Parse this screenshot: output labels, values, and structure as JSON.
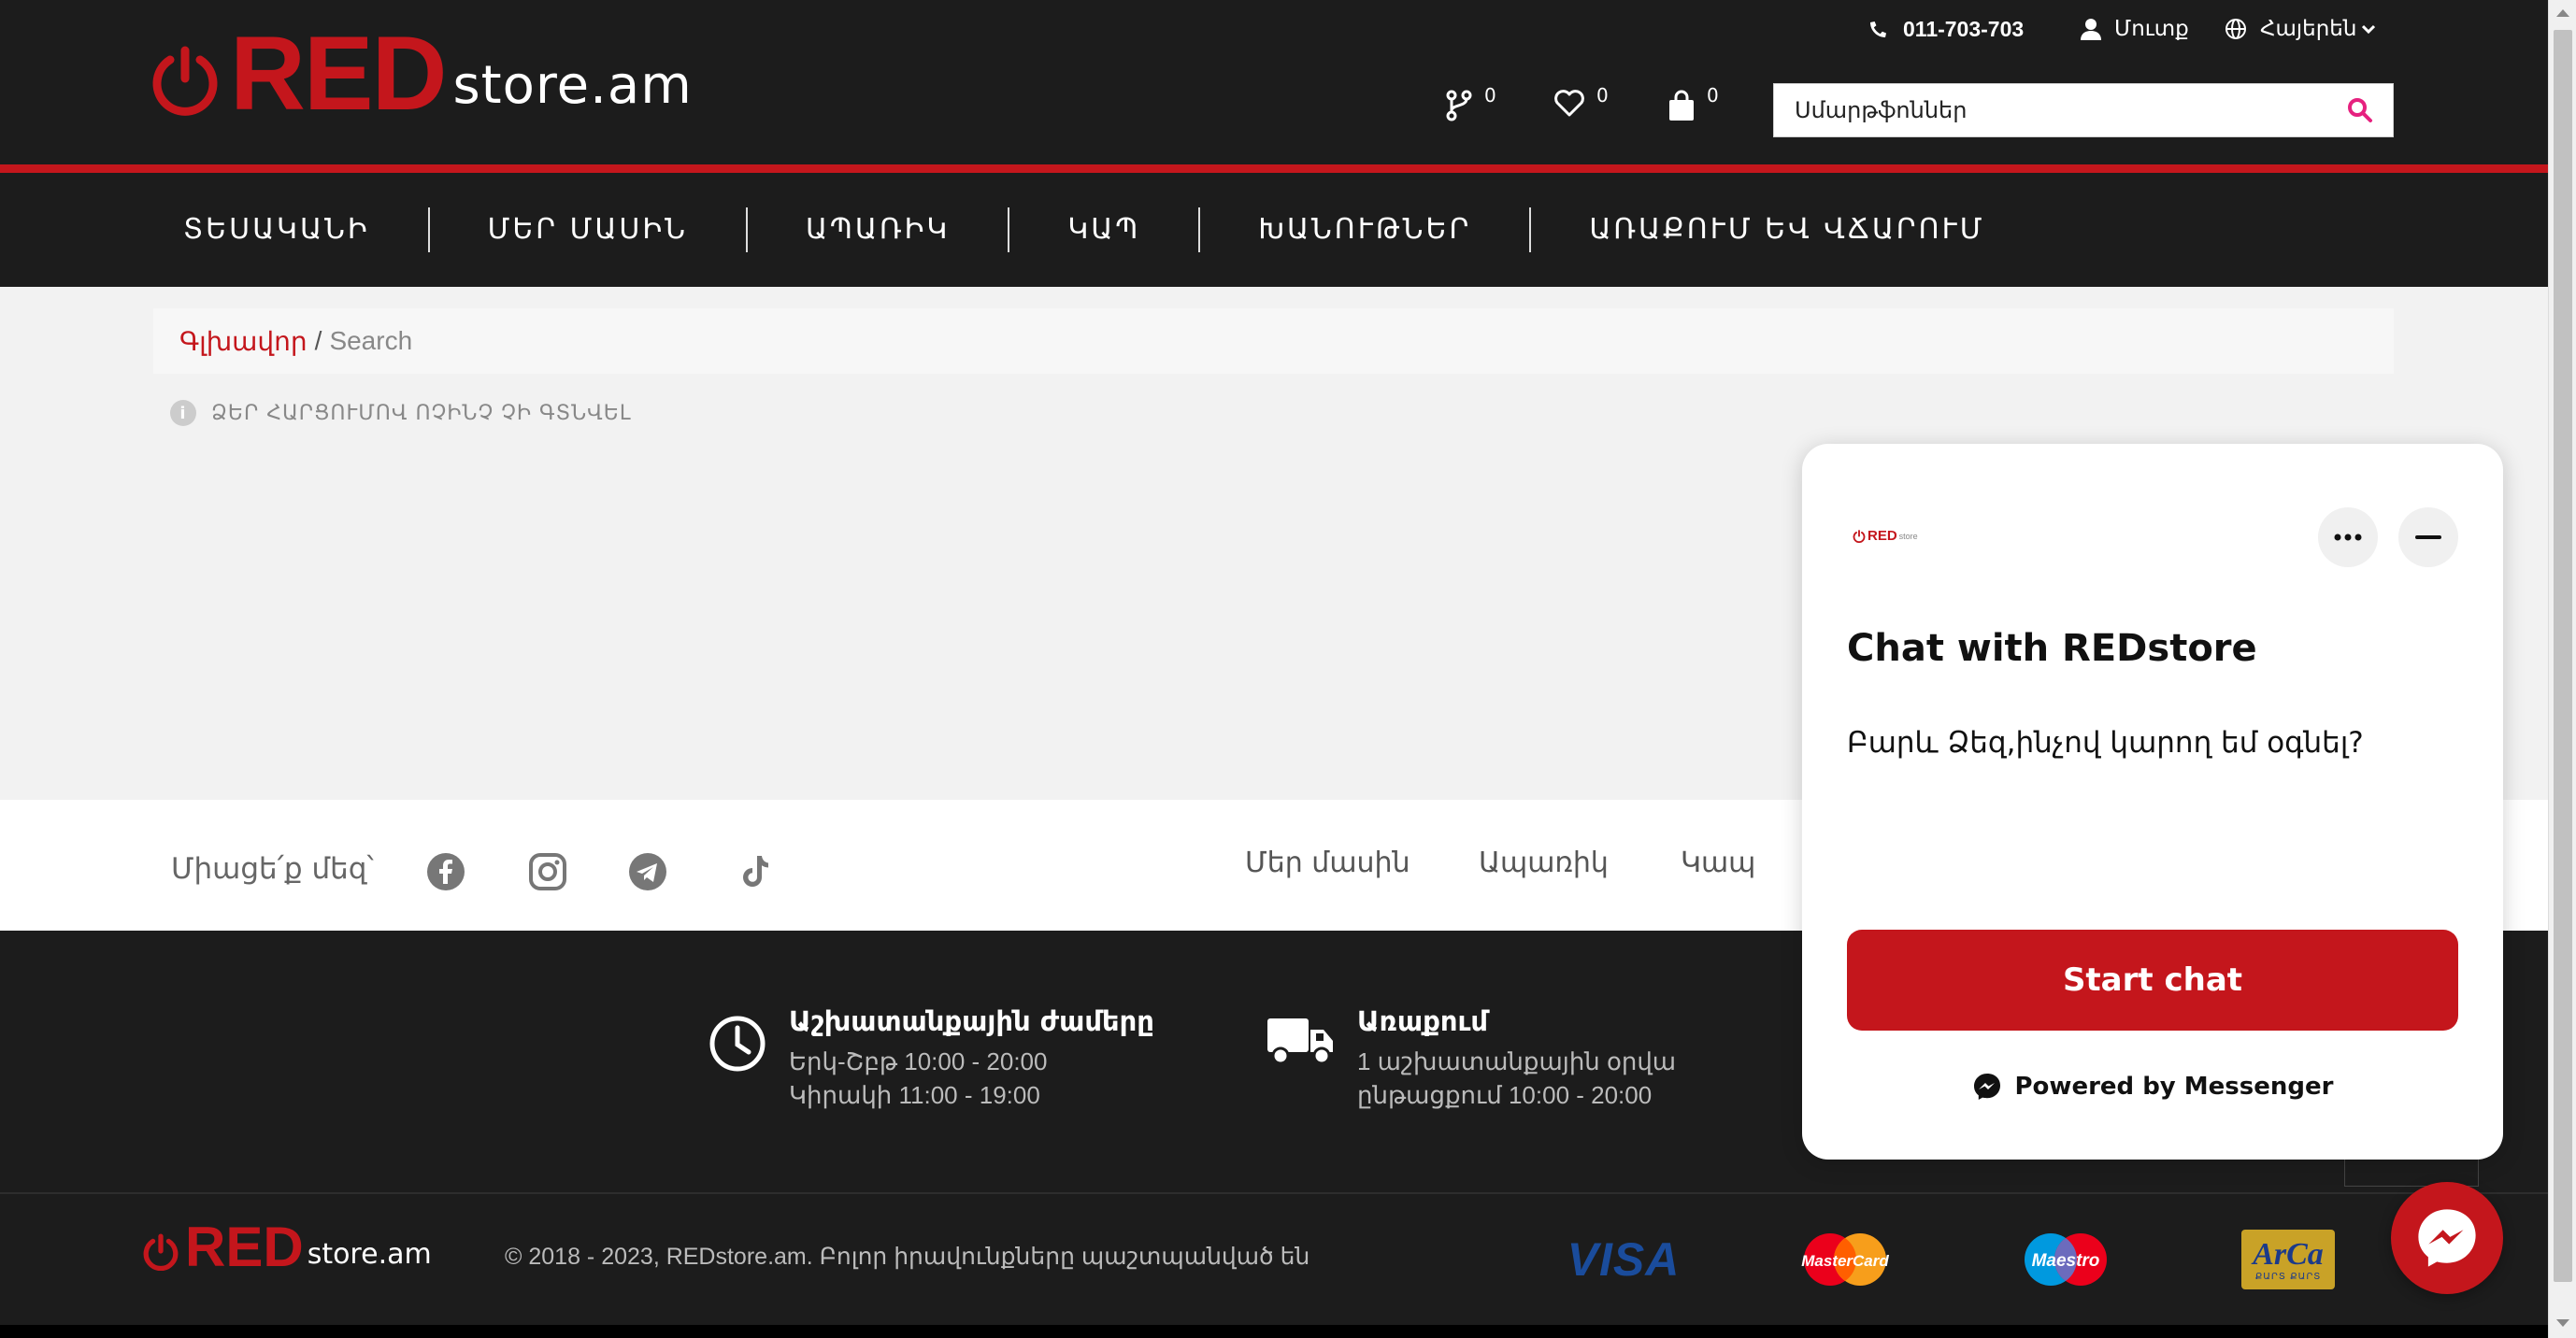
{
  "header": {
    "logo": {
      "red": "RED",
      "rest": "store.am"
    },
    "phone": "011-703-703",
    "login": "Մուտք",
    "language": "Հայերեն",
    "compare_count": "0",
    "wishlist_count": "0",
    "cart_count": "0",
    "search": {
      "value": "Սմարթֆոններ",
      "placeholder": "Սմարթֆոններ"
    }
  },
  "nav": {
    "items": [
      {
        "label": "ՏԵՍԱԿԱՆԻ"
      },
      {
        "label": "ՄԵՐ ՄԱՍԻՆ"
      },
      {
        "label": "ԱՊԱՌԻԿ"
      },
      {
        "label": "ԿԱՊ"
      },
      {
        "label": "ԽԱՆՈՒԹՆԵՐ"
      },
      {
        "label": "ԱՌԱՔՈՒՄ ԵՎ ՎՃԱՐՈՒՄ"
      }
    ]
  },
  "breadcrumb": {
    "home": "Գլխավոր",
    "separator": "/",
    "current": "Search"
  },
  "notice": "ՁԵՐ ՀԱՐՑՈՒՄՈՎ ՈՉԻՆՉ ՉԻ ԳՏՆՎԵԼ",
  "footer": {
    "join_label": "Միացե՛ք մեզ՝",
    "social": [
      "facebook-icon",
      "instagram-icon",
      "telegram-icon",
      "tiktok-icon"
    ],
    "links": [
      {
        "label": "Մեր մասին"
      },
      {
        "label": "Ապառիկ"
      },
      {
        "label": "Կապ"
      }
    ],
    "hours": {
      "title": "Աշխատանքային ժամերը",
      "line1": "Երկ-Շբթ 10:00 -  20:00",
      "line2": "Կիրակի 11:00 - 19:00"
    },
    "delivery": {
      "title": "Առաքում",
      "line1": "1 աշխատանքային օրվա",
      "line2": "ընթացքում 10:00 - 20:00"
    },
    "logo": {
      "red": "RED",
      "rest": "store.am"
    },
    "copyright": "© 2018 - 2023, REDstore.am. Բոլոր իրավունքները պաշտպանված են",
    "payments": {
      "visa": "VISA",
      "mastercard": "MasterCard",
      "maestro": "Maestro",
      "arca": "ArCa",
      "arca_sub": "ՔԱՐՏ ՔԱՐՏ"
    }
  },
  "chat": {
    "logo_red": "RED",
    "logo_rest": "store",
    "title": "Chat with REDstore",
    "message": "Բարև Ձեզ,ինչով կարող եմ օգնել?",
    "start_label": "Start chat",
    "powered": "Powered by Messenger"
  },
  "colors": {
    "brand_red": "#c4161c",
    "dark": "#1c1c1c",
    "search_icon": "#e6217f"
  }
}
